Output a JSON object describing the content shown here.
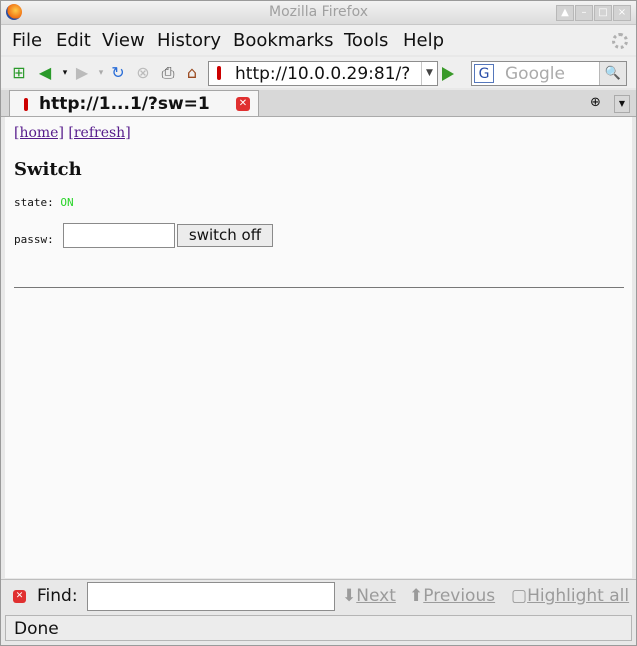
{
  "window": {
    "title": "Mozilla Firefox"
  },
  "menu": {
    "items": [
      {
        "label": "File"
      },
      {
        "label": "Edit"
      },
      {
        "label": "View"
      },
      {
        "label": "History"
      },
      {
        "label": "Bookmarks"
      },
      {
        "label": "Tools"
      },
      {
        "label": "Help"
      }
    ]
  },
  "nav": {
    "url": "http://10.0.0.29:81/?",
    "search_placeholder": "Google",
    "search_engine_icon": "google-g-icon"
  },
  "tabs": [
    {
      "title": "http://1...1/?sw=1",
      "active": true
    }
  ],
  "page": {
    "home_link": "[home]",
    "refresh_link": "[refresh]",
    "heading": "Switch",
    "state_label": "state:",
    "state_value": "ON",
    "passw_label": "passw:",
    "passw_value": "",
    "switch_button": "switch off",
    "state_color": "#28d428"
  },
  "findbar": {
    "label": "Find:",
    "value": "",
    "next": "Next",
    "previous": "Previous",
    "highlight": "Highlight all"
  },
  "status": {
    "text": "Done"
  }
}
